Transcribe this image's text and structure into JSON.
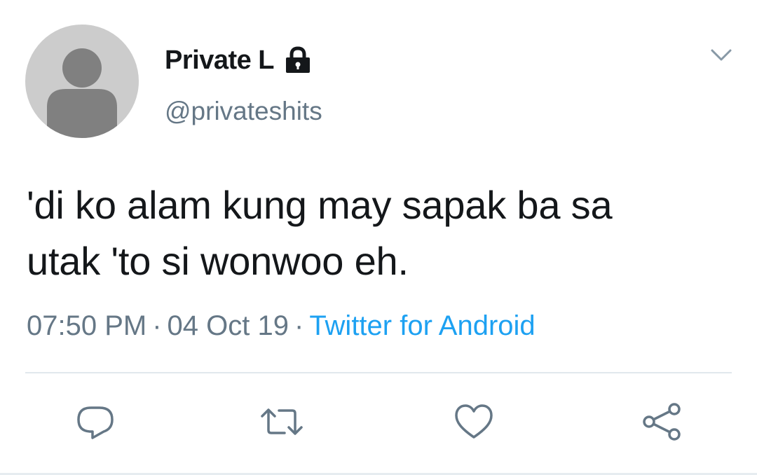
{
  "user": {
    "display_name": "Private L",
    "handle": "@privateshits",
    "protected": true
  },
  "tweet": {
    "text_line1": "'di ko alam kung may sapak ba sa",
    "text_line2": "utak 'to si wonwoo eh."
  },
  "meta": {
    "time": "07:50 PM",
    "separator": "·",
    "date": "04 Oct 19",
    "source": "Twitter for Android"
  },
  "actions": [
    {
      "name": "reply",
      "icon": "reply-icon"
    },
    {
      "name": "retweet",
      "icon": "retweet-icon"
    },
    {
      "name": "like",
      "icon": "heart-icon"
    },
    {
      "name": "share",
      "icon": "share-icon"
    }
  ],
  "colors": {
    "text_primary": "#14171a",
    "text_secondary": "#657786",
    "accent": "#1da1f2",
    "avatar_bg": "#cccccc",
    "avatar_fg": "#808080"
  }
}
